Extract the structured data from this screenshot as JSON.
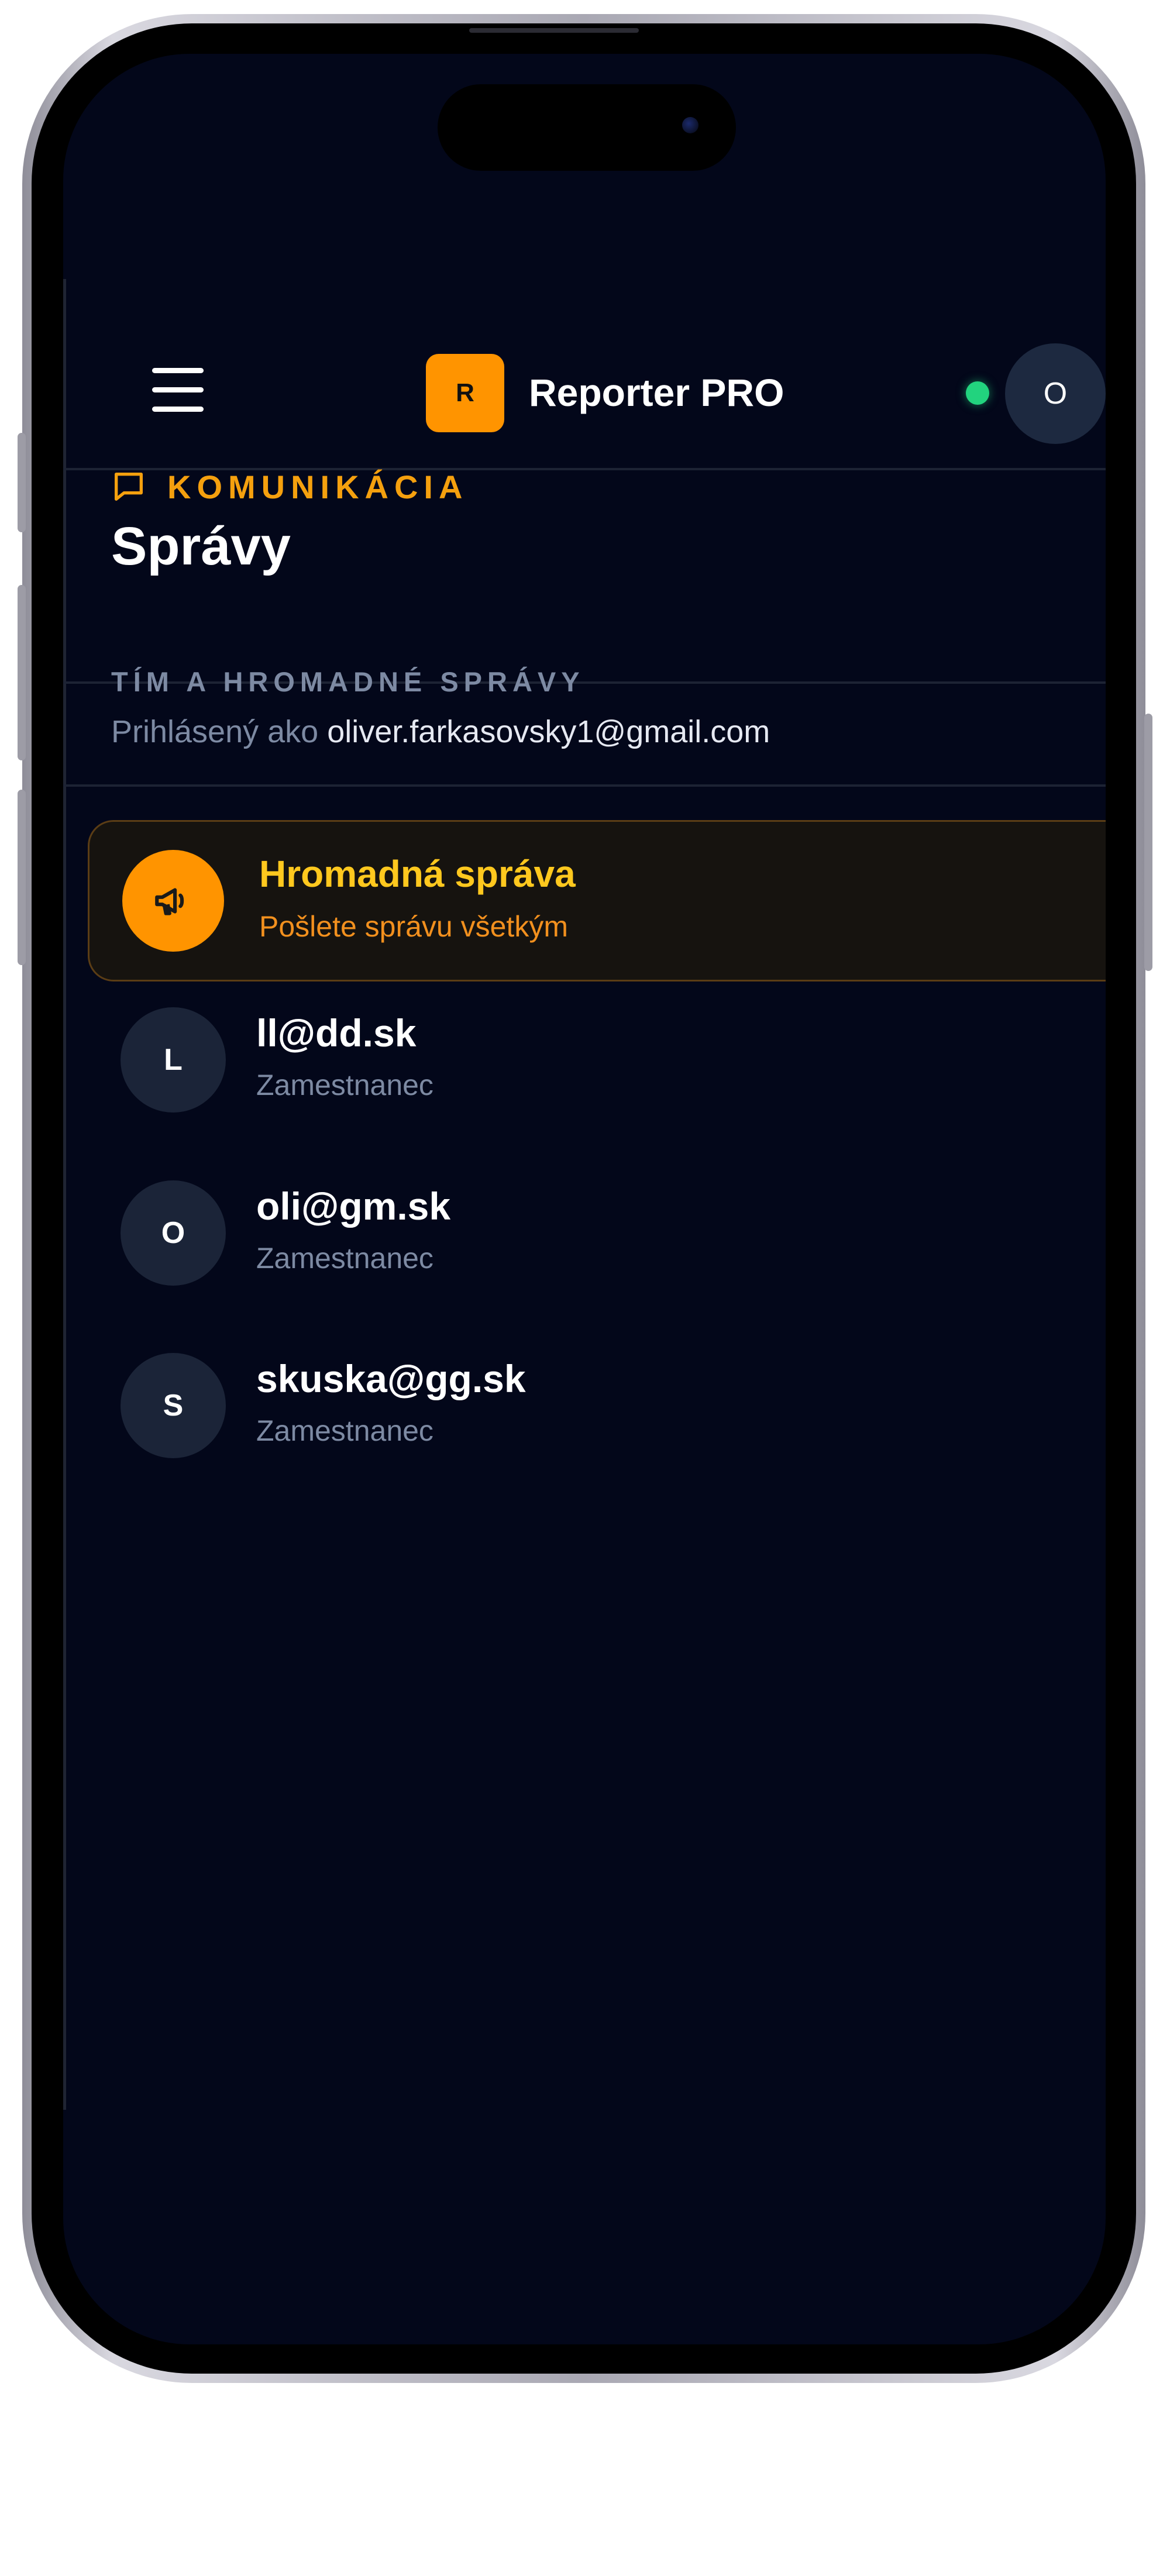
{
  "header": {
    "logo_letter": "R",
    "app_name": "Reporter PRO",
    "user_initial": "O",
    "online_status_color": "#22d37e",
    "menu_icon": "hamburger-icon"
  },
  "section": {
    "kicker": "KOMUNIKÁCIA",
    "kicker_icon": "chat-bubble-icon",
    "title": "Správy"
  },
  "team": {
    "label": "TÍM A HROMADNÉ SPRÁVY",
    "logged_in_prefix": "Prihlásený ako",
    "logged_in_email": "oliver.farkasovsky1@gmail.com"
  },
  "bulk_message": {
    "icon": "megaphone-icon",
    "title": "Hromadná správa",
    "subtitle": "Pošlete správu všetkým"
  },
  "contacts": [
    {
      "initial": "L",
      "email": "ll@dd.sk",
      "role": "Zamestnanec"
    },
    {
      "initial": "O",
      "email": "oli@gm.sk",
      "role": "Zamestnanec"
    },
    {
      "initial": "S",
      "email": "skuska@gg.sk",
      "role": "Zamestnanec"
    }
  ],
  "colors": {
    "background": "#03071a",
    "accent": "#ff9400",
    "kicker": "#f5a00e",
    "bulk_title": "#ffc81e",
    "muted": "#7d8aa3"
  }
}
